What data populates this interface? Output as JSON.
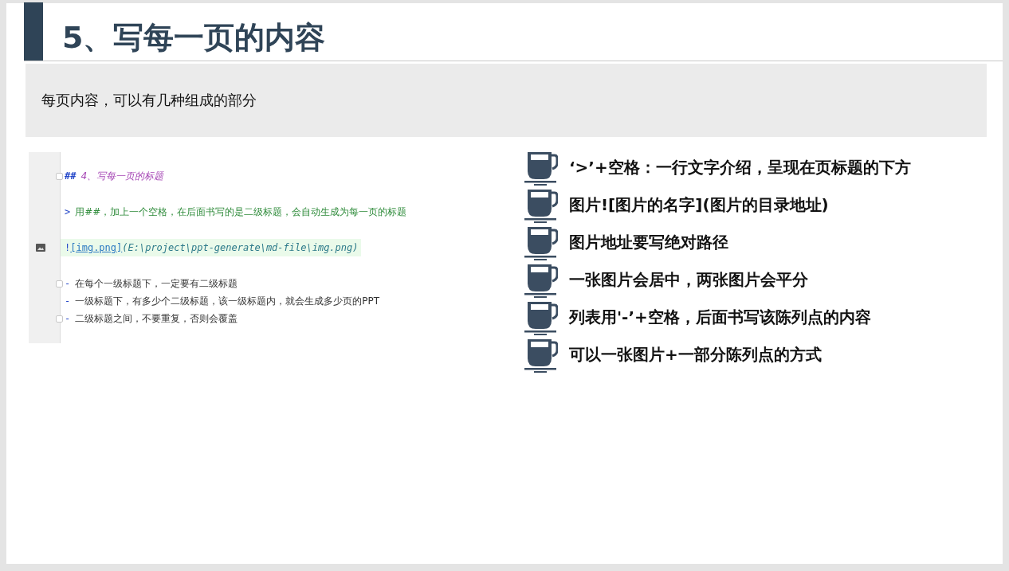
{
  "title": "5、写每一页的内容",
  "subtitle": "每页内容，可以有几种组成的部分",
  "editor": {
    "lines": [
      {
        "kind": "heading",
        "fold_marker": true,
        "marker": "##",
        "text": "4、写每一页的标题"
      },
      {
        "kind": "quote",
        "fold_marker": false,
        "marker": ">",
        "text": "用##，加上一个空格，在后面书写的是二级标题，会自动生成为每一页的标题"
      },
      {
        "kind": "image",
        "fold_marker": false,
        "marker": "!",
        "link": "[img.png]",
        "text": "(E:\\project\\ppt-generate\\md-file\\img.png)"
      },
      {
        "kind": "list",
        "fold_marker": true,
        "marker": "-",
        "text": "在每个一级标题下，一定要有二级标题"
      },
      {
        "kind": "list",
        "fold_marker": false,
        "marker": "-",
        "text": "一级标题下，有多少个二级标题，该一级标题内，就会生成多少页的PPT"
      },
      {
        "kind": "list",
        "fold_marker": true,
        "marker": "-",
        "text": "二级标题之间，不要重复，否则会覆盖"
      }
    ]
  },
  "points": [
    "‘>’+空格：一行文字介绍，呈现在页标题的下方",
    "图片![图片的名字](图片的目录地址)",
    "图片地址要写绝对路径",
    "一张图片会居中，两张图片会平分",
    "列表用'-’+空格，后面书写该陈列点的内容",
    "可以一张图片+一部分陈列点的方式"
  ]
}
